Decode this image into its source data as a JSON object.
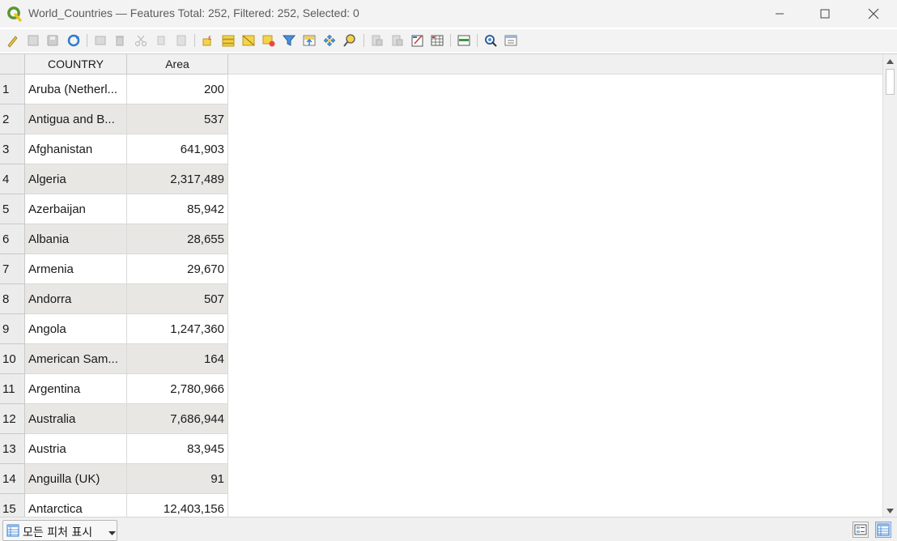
{
  "window": {
    "title": "World_Countries — Features Total: 252, Filtered: 252, Selected: 0",
    "controls": {
      "minimize_icon": "minimize-icon",
      "maximize_icon": "maximize-icon",
      "close_icon": "close-icon"
    }
  },
  "toolbar": {
    "icons": [
      "toggle-editing-icon",
      "multi-edit-icon",
      "save-edits-icon",
      "reload-icon",
      "add-feature-icon",
      "delete-feature-icon",
      "cut-icon",
      "copy-icon",
      "paste-icon",
      "select-expression-icon",
      "select-all-icon",
      "invert-selection-icon",
      "deselect-all-icon",
      "filter-selection-icon",
      "move-selection-top-icon",
      "pan-to-selection-icon",
      "zoom-to-selection-icon",
      "new-field-icon",
      "delete-field-icon",
      "field-calculator-icon",
      "conditional-format-icon",
      "dock-table-icon",
      "actions-icon",
      "organize-columns-icon"
    ]
  },
  "table": {
    "columns": [
      "COUNTRY",
      "Area"
    ],
    "rows": [
      {
        "num": "1",
        "country": "Aruba (Netherl...",
        "area": "200"
      },
      {
        "num": "2",
        "country": "Antigua and B...",
        "area": "537"
      },
      {
        "num": "3",
        "country": "Afghanistan",
        "area": "641,903"
      },
      {
        "num": "4",
        "country": "Algeria",
        "area": "2,317,489"
      },
      {
        "num": "5",
        "country": "Azerbaijan",
        "area": "85,942"
      },
      {
        "num": "6",
        "country": "Albania",
        "area": "28,655"
      },
      {
        "num": "7",
        "country": "Armenia",
        "area": "29,670"
      },
      {
        "num": "8",
        "country": "Andorra",
        "area": "507"
      },
      {
        "num": "9",
        "country": "Angola",
        "area": "1,247,360"
      },
      {
        "num": "10",
        "country": "American Sam...",
        "area": "164"
      },
      {
        "num": "11",
        "country": "Argentina",
        "area": "2,780,966"
      },
      {
        "num": "12",
        "country": "Australia",
        "area": "7,686,944"
      },
      {
        "num": "13",
        "country": "Austria",
        "area": "83,945"
      },
      {
        "num": "14",
        "country": "Anguilla (UK)",
        "area": "91"
      },
      {
        "num": "15",
        "country": "Antarctica",
        "area": "12,403,156"
      }
    ]
  },
  "status": {
    "filter_label": "모든 피처 표시",
    "form_view_icon": "form-view-icon",
    "table_view_icon": "table-view-icon"
  },
  "colors": {
    "accent": "#2e7bcf",
    "alt_row": "#e9e7e4",
    "logo_green": "#589632"
  }
}
